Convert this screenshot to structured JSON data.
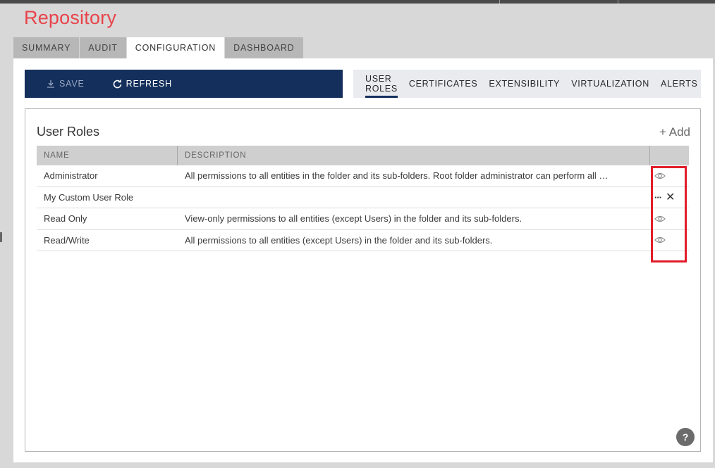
{
  "app": {
    "title": "Repository"
  },
  "main_tabs": [
    {
      "label": "SUMMARY",
      "active": false
    },
    {
      "label": "AUDIT",
      "active": false
    },
    {
      "label": "CONFIGURATION",
      "active": true
    },
    {
      "label": "DASHBOARD",
      "active": false
    }
  ],
  "toolbar": {
    "save_label": "SAVE",
    "save_icon": "download-icon",
    "refresh_label": "REFRESH",
    "refresh_icon": "refresh-icon"
  },
  "sub_tabs": [
    {
      "label": "USER ROLES",
      "active": true
    },
    {
      "label": "CERTIFICATES",
      "active": false
    },
    {
      "label": "EXTENSIBILITY",
      "active": false
    },
    {
      "label": "VIRTUALIZATION",
      "active": false
    },
    {
      "label": "ALERTS",
      "active": false
    }
  ],
  "section": {
    "title": "User Roles",
    "add_label": "+ Add"
  },
  "table": {
    "columns": [
      "NAME",
      "DESCRIPTION"
    ],
    "rows": [
      {
        "name": "Administrator",
        "description": "All permissions to all entities in the folder and its sub-folders. Root folder administrator can perform all …",
        "actions": [
          "eye-icon"
        ]
      },
      {
        "name": "My Custom User Role",
        "description": "",
        "actions": [
          "more-icon",
          "close-icon"
        ]
      },
      {
        "name": "Read Only",
        "description": "View-only permissions to all entities (except Users) in the folder and its sub-folders.",
        "actions": [
          "eye-icon"
        ]
      },
      {
        "name": "Read/Write",
        "description": "All permissions to all entities (except Users) in the folder and its sub-folders.",
        "actions": [
          "eye-icon"
        ]
      }
    ]
  },
  "help": {
    "label": "?"
  },
  "colors": {
    "title_red": "#e8434a",
    "toolbar_navy": "#142f5c",
    "highlight_red": "#e11d2a"
  }
}
